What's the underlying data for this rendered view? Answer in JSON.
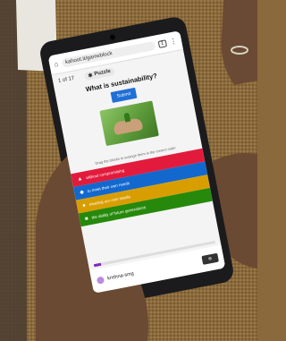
{
  "browser": {
    "home_icon": "home-icon",
    "url": "kahoot.it/gameblock",
    "tab_count": "1",
    "menu_icon": "kebab-menu-icon"
  },
  "quiz": {
    "question_counter": "1 of 17",
    "type_label": "Puzzle",
    "type_icon": "puzzle-icon",
    "question": "What is sustainability?",
    "submit_label": "Submit",
    "instruction": "Drag the blocks to arrange them in the correct order",
    "answers": [
      {
        "text": "without compromising",
        "color": "#e21b3c",
        "shape": "▲"
      },
      {
        "text": "to meet their own needs",
        "color": "#1368ce",
        "shape": "◆"
      },
      {
        "text": "meeting our own needs",
        "color": "#d89e00",
        "shape": "●"
      },
      {
        "text": "the ability of future generations",
        "color": "#26890c",
        "shape": "■"
      }
    ],
    "progress_fraction": 0.06
  },
  "player": {
    "nickname": "krishna-smg"
  },
  "colors": {
    "table": "#8a6a3c",
    "phone_body": "#1b1b1d",
    "skin": "#6b4a33",
    "kahoot_purple": "#7b2cbf"
  }
}
